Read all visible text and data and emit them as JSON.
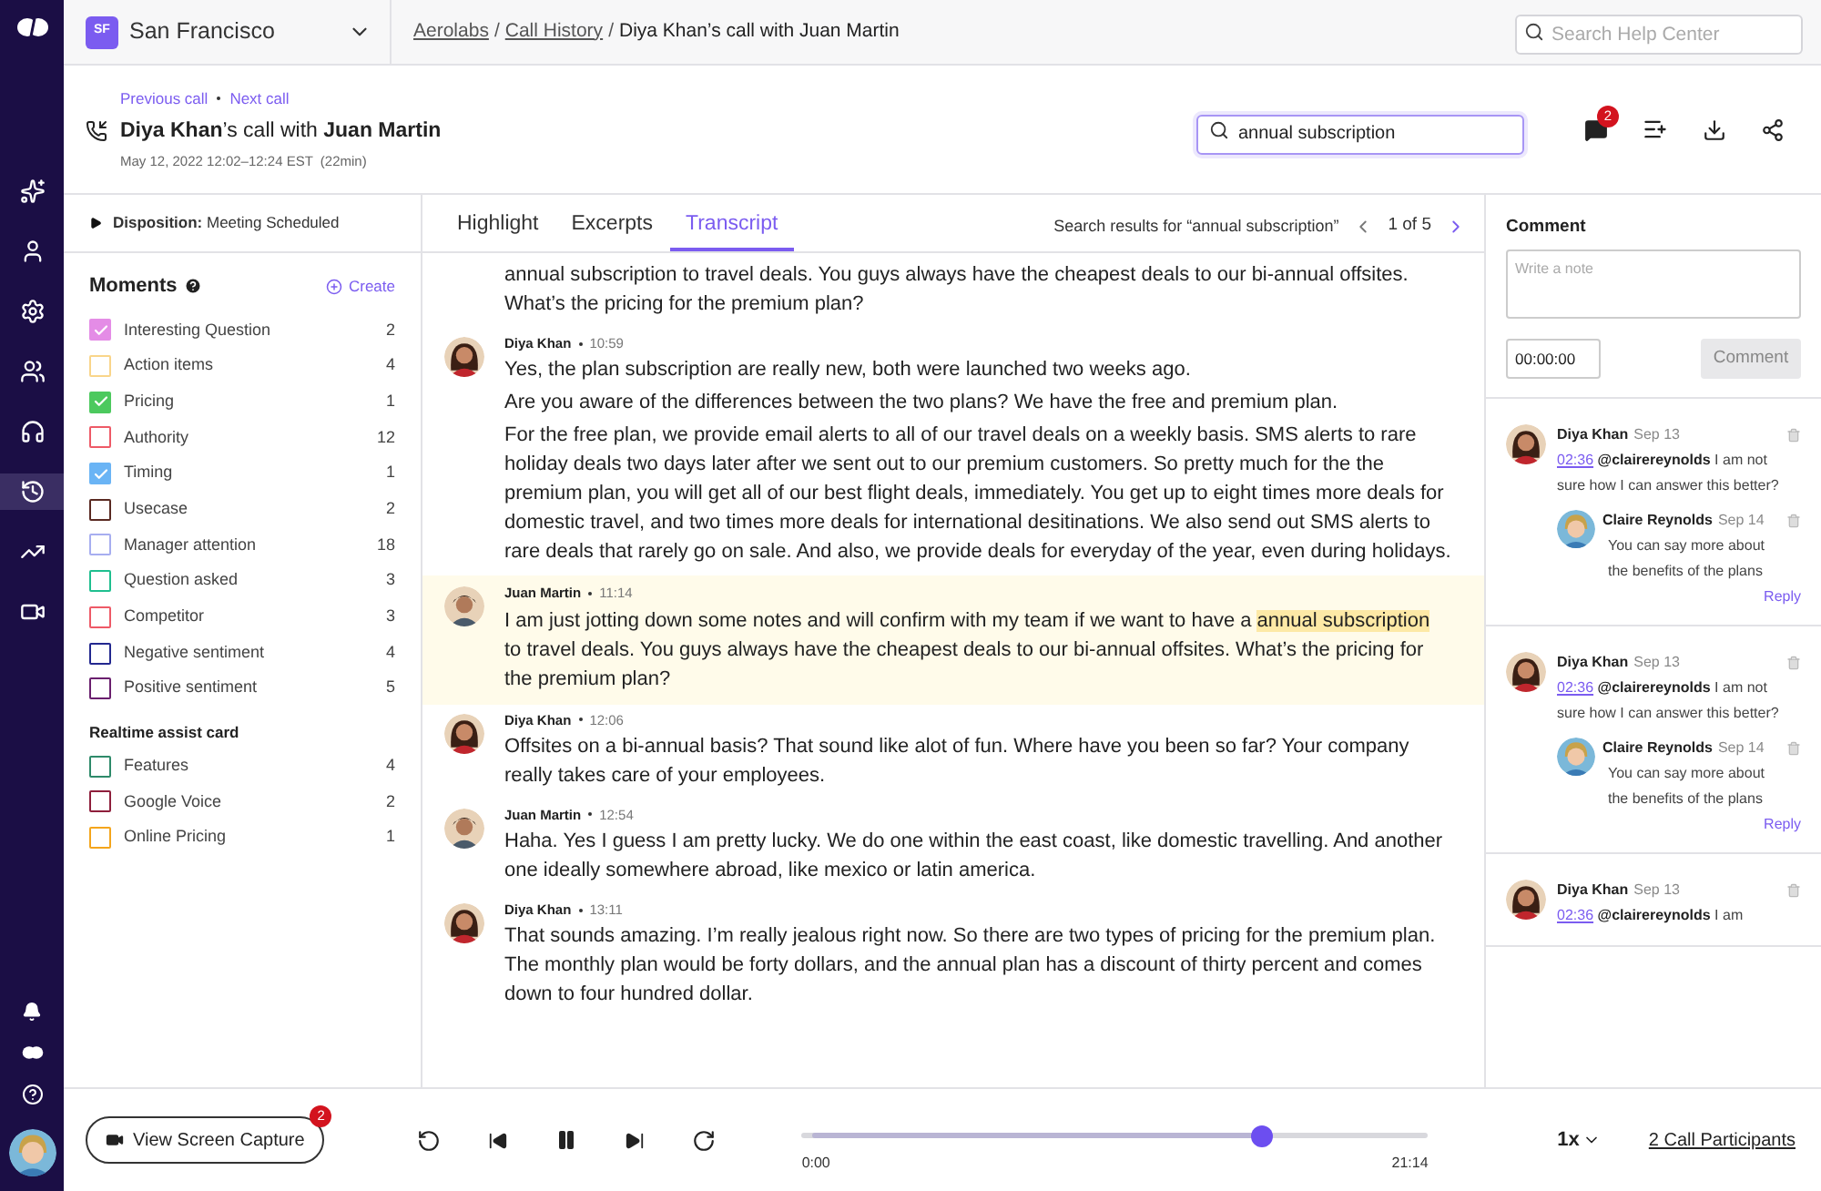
{
  "workspace": {
    "initials": "SF",
    "name": "San Francisco"
  },
  "breadcrumbs": {
    "separator": "/",
    "items": [
      {
        "label": "Aerolabs",
        "link": true
      },
      {
        "label": "Call History",
        "link": true
      },
      {
        "label": "Diya Khan’s call with Juan Martin",
        "link": false
      }
    ]
  },
  "help_search": {
    "placeholder": "Search Help Center"
  },
  "call": {
    "previous": "Previous call",
    "next": "Next call",
    "caller": "Diya Khan",
    "title_middle": "’s call with ",
    "callee": "Juan Martin",
    "date": "May 12, 2022 12:02–12:24 EST",
    "duration": "(22min)"
  },
  "transcript_search": {
    "value": "annual subscription"
  },
  "comment_badge": "2",
  "disposition": {
    "label": "Disposition:",
    "value": "Meeting Scheduled"
  },
  "moments": {
    "title": "Moments",
    "create": "Create",
    "items": [
      {
        "label": "Interesting Question",
        "count": "2",
        "color": "#e48ce6",
        "checked": true
      },
      {
        "label": "Action items",
        "count": "4",
        "color": "#f9d58a",
        "checked": false
      },
      {
        "label": "Pricing",
        "count": "1",
        "color": "#4cc95e",
        "checked": true
      },
      {
        "label": "Authority",
        "count": "12",
        "color": "#ee5a67",
        "checked": false
      },
      {
        "label": "Timing",
        "count": "1",
        "color": "#6ab4f5",
        "checked": true
      },
      {
        "label": "Usecase",
        "count": "2",
        "color": "#5a2a22",
        "checked": false
      },
      {
        "label": "Manager attention",
        "count": "18",
        "color": "#a7aef0",
        "checked": false
      },
      {
        "label": "Question asked",
        "count": "3",
        "color": "#1fbf8f",
        "checked": false
      },
      {
        "label": "Competitor",
        "count": "3",
        "color": "#ee5a67",
        "checked": false
      },
      {
        "label": "Negative sentiment",
        "count": "4",
        "color": "#23288f",
        "checked": false
      },
      {
        "label": "Positive sentiment",
        "count": "5",
        "color": "#6a1f6e",
        "checked": false
      }
    ]
  },
  "assist": {
    "title": "Realtime assist card",
    "items": [
      {
        "label": "Features",
        "count": "4",
        "color": "#2e8a6a",
        "checked": false
      },
      {
        "label": "Google Voice",
        "count": "2",
        "color": "#8e1f3c",
        "checked": false
      },
      {
        "label": "Online Pricing",
        "count": "1",
        "color": "#f4a51c",
        "checked": false
      }
    ]
  },
  "tabs": [
    {
      "label": "Highlight",
      "selected": false
    },
    {
      "label": "Excerpts",
      "selected": false
    },
    {
      "label": "Transcript",
      "selected": true
    }
  ],
  "search_results": {
    "label": "Search results for “annual subscription”",
    "position": "1 of 5"
  },
  "messages": [
    {
      "highlighted": false,
      "paragraphs": [
        [
          {
            "text": "annual subscription to travel deals. You guys always have the cheapest deals to our bi-annual offsites. What’s the pricing for the premium plan?",
            "match": false
          }
        ]
      ]
    },
    {
      "speaker": "Diya Khan",
      "time": "10:59",
      "kind": "female",
      "highlighted": false,
      "paragraphs": [
        [
          {
            "text": "Yes, the plan subscription are really new, both were launched two weeks ago.",
            "match": false
          }
        ],
        [
          {
            "text": "Are you aware of the differences between the two plans? We have the free and premium plan.",
            "match": false
          }
        ],
        [
          {
            "text": "For the free plan, we provide email alerts to all of our travel deals on a weekly basis. SMS alerts to rare holiday deals two days later after we sent out to our premium customers. So pretty much for the the premium plan, you will get all of our best flight deals, immediately. You get up to eight times more deals for domestic travel, and two times more deals for international desitinations. We also send out SMS alerts to rare deals that rarely go on sale. And also, we provide deals for everyday of the year, even during holidays.",
            "match": false
          }
        ]
      ]
    },
    {
      "speaker": "Juan Martin",
      "time": "11:14",
      "kind": "male",
      "highlighted": true,
      "paragraphs": [
        [
          {
            "text": "I am just jotting down some notes and will confirm with my team if we want to have a ",
            "match": false
          },
          {
            "text": "annual subscription",
            "match": true
          },
          {
            "text": " to travel deals. You guys always have the cheapest deals to our bi-annual offsites. What’s the pricing for the premium plan?",
            "match": false
          }
        ]
      ]
    },
    {
      "speaker": "Diya Khan",
      "time": "12:06",
      "kind": "female",
      "highlighted": false,
      "paragraphs": [
        [
          {
            "text": "Offsites on a bi-annual basis? That sound like alot of fun. Where have you been so far? Your company really takes care of your employees.",
            "match": false
          }
        ]
      ]
    },
    {
      "speaker": "Juan Martin",
      "time": "12:54",
      "kind": "male",
      "highlighted": false,
      "paragraphs": [
        [
          {
            "text": "Haha. Yes I guess I am pretty lucky. We do one within the east coast, like domestic travelling. And another one ideally somewhere abroad, like mexico or latin america.",
            "match": false
          }
        ]
      ]
    },
    {
      "speaker": "Diya Khan",
      "time": "13:11",
      "kind": "female",
      "highlighted": false,
      "paragraphs": [
        [
          {
            "text": "That sounds amazing. I’m really jealous right now. So there are two types of pricing for the premium plan. The monthly plan would be forty dollars, and the annual plan has a discount of thirty percent and comes down to four hundred dollar.",
            "match": false
          }
        ]
      ]
    }
  ],
  "comment_form": {
    "title": "Comment",
    "placeholder": "Write a note",
    "time": "00:00:00",
    "button": "Comment"
  },
  "comments": [
    {
      "author": "Diya Khan",
      "date": "Sep 13",
      "timestamp": "02:36",
      "mention": "@clairereynolds",
      "text": " I am not sure how I can answer this better?",
      "reply": {
        "author": "Claire Reynolds",
        "date": "Sep 14",
        "text": "You can say more about the benefits of the plans"
      },
      "reply_link": "Reply"
    },
    {
      "author": "Diya Khan",
      "date": "Sep 13",
      "timestamp": "02:36",
      "mention": "@clairereynolds",
      "text": " I am not sure how I can answer this better?",
      "reply": {
        "author": "Claire Reynolds",
        "date": "Sep 14",
        "text": "You can say more about the benefits of the plans"
      },
      "reply_link": "Reply"
    },
    {
      "author": "Diya Khan",
      "date": "Sep 13",
      "timestamp": "02:36",
      "mention": "@clairereynolds",
      "text": " I am"
    }
  ],
  "player": {
    "capture": "View Screen Capture",
    "capture_badge": "2",
    "elapsed": "0:00",
    "total": "21:14",
    "level": 0.743,
    "playing": true,
    "speed": "1x",
    "participants": "2 Call Participants"
  }
}
